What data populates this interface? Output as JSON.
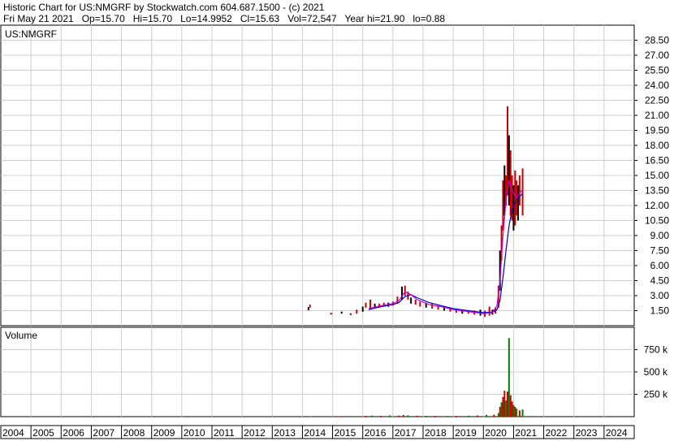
{
  "header": {
    "title_line": "Historic Chart for US:NMGRF by Stockwatch.com 604.687.1500 - (c) 2021",
    "quote_line": "Fri May 21 2021   Op=15.70   Hi=15.70   Lo=14.9952   Cl=15.63   Vol=72,547   Year hi=21.90   lo=0.88"
  },
  "chart_data": [
    {
      "type": "candlestick",
      "title": "US:NMGRF",
      "ylim": [
        0,
        30
      ],
      "y_ticks": [
        "1.50",
        "3.00",
        "4.50",
        "6.00",
        "7.50",
        "9.00",
        "10.50",
        "12.00",
        "13.50",
        "15.00",
        "16.50",
        "18.00",
        "19.50",
        "21.00",
        "22.50",
        "24.00",
        "25.50",
        "27.00",
        "28.50"
      ],
      "grid": true,
      "series": [
        {
          "kind": "price_high_low",
          "points": [
            [
              2014.2,
              1.55,
              1.85
            ],
            [
              2014.25,
              1.8,
              2.1
            ],
            [
              2014.95,
              1.1,
              1.3
            ],
            [
              2015.3,
              1.2,
              1.4
            ],
            [
              2015.6,
              1.05,
              1.25
            ],
            [
              2015.8,
              1.2,
              1.6
            ],
            [
              2016.0,
              1.4,
              1.9
            ],
            [
              2016.1,
              1.8,
              2.3
            ],
            [
              2016.25,
              1.6,
              2.6
            ],
            [
              2016.4,
              1.7,
              2.2
            ],
            [
              2016.55,
              1.8,
              2.2
            ],
            [
              2016.7,
              1.9,
              2.3
            ],
            [
              2016.85,
              1.9,
              2.3
            ],
            [
              2017.0,
              2.0,
              2.4
            ],
            [
              2017.15,
              2.2,
              2.9
            ],
            [
              2017.3,
              2.6,
              3.9
            ],
            [
              2017.4,
              3.0,
              4.0
            ],
            [
              2017.5,
              2.6,
              3.4
            ],
            [
              2017.6,
              2.2,
              2.8
            ],
            [
              2017.75,
              2.1,
              2.6
            ],
            [
              2017.9,
              1.9,
              2.4
            ],
            [
              2018.1,
              1.8,
              2.3
            ],
            [
              2018.3,
              1.7,
              2.2
            ],
            [
              2018.5,
              1.6,
              2.0
            ],
            [
              2018.7,
              1.5,
              1.9
            ],
            [
              2018.9,
              1.4,
              1.8
            ],
            [
              2019.1,
              1.3,
              1.7
            ],
            [
              2019.3,
              1.2,
              1.6
            ],
            [
              2019.5,
              1.2,
              1.5
            ],
            [
              2019.7,
              1.1,
              1.5
            ],
            [
              2019.9,
              1.0,
              1.6
            ],
            [
              2020.05,
              0.88,
              1.5
            ],
            [
              2020.2,
              1.0,
              1.9
            ],
            [
              2020.3,
              1.1,
              1.6
            ],
            [
              2020.4,
              1.2,
              1.8
            ],
            [
              2020.5,
              1.8,
              4.0
            ],
            [
              2020.55,
              3.5,
              7.5
            ],
            [
              2020.6,
              6.5,
              10.0
            ],
            [
              2020.65,
              9.5,
              14.5
            ],
            [
              2020.7,
              11.0,
              16.0
            ],
            [
              2020.75,
              12.0,
              15.0
            ],
            [
              2020.8,
              13.0,
              21.9
            ],
            [
              2020.85,
              12.0,
              19.0
            ],
            [
              2020.9,
              11.0,
              17.5
            ],
            [
              2020.95,
              10.5,
              15.0
            ],
            [
              2021.0,
              9.5,
              14.0
            ],
            [
              2021.05,
              10.0,
              15.5
            ],
            [
              2021.1,
              11.0,
              14.5
            ],
            [
              2021.15,
              10.5,
              14.0
            ],
            [
              2021.2,
              12.0,
              15.0
            ],
            [
              2021.3,
              11.0,
              15.7
            ]
          ]
        },
        {
          "kind": "moving_average",
          "color": "#0000cc",
          "points": [
            [
              2016.2,
              1.6
            ],
            [
              2016.6,
              1.9
            ],
            [
              2017.0,
              2.1
            ],
            [
              2017.2,
              2.3
            ],
            [
              2017.4,
              2.9
            ],
            [
              2017.6,
              3.1
            ],
            [
              2017.8,
              2.8
            ],
            [
              2018.2,
              2.3
            ],
            [
              2018.6,
              2.0
            ],
            [
              2019.0,
              1.7
            ],
            [
              2019.5,
              1.5
            ],
            [
              2020.0,
              1.3
            ],
            [
              2020.3,
              1.35
            ],
            [
              2020.45,
              1.6
            ],
            [
              2020.55,
              2.5
            ],
            [
              2020.65,
              4.8
            ],
            [
              2020.75,
              7.5
            ],
            [
              2020.85,
              10.0
            ],
            [
              2020.95,
              11.6
            ],
            [
              2021.1,
              12.6
            ],
            [
              2021.3,
              13.2
            ]
          ]
        },
        {
          "kind": "moving_average",
          "color": "#cc00cc",
          "points": [
            [
              2016.2,
              1.7
            ],
            [
              2016.6,
              2.0
            ],
            [
              2017.0,
              2.2
            ],
            [
              2017.2,
              2.5
            ],
            [
              2017.4,
              3.4
            ],
            [
              2017.6,
              3.1
            ],
            [
              2017.8,
              2.6
            ],
            [
              2018.2,
              2.1
            ],
            [
              2018.6,
              1.9
            ],
            [
              2019.0,
              1.6
            ],
            [
              2019.5,
              1.4
            ],
            [
              2020.0,
              1.2
            ],
            [
              2020.3,
              1.3
            ],
            [
              2020.45,
              2.0
            ],
            [
              2020.55,
              4.5
            ],
            [
              2020.65,
              9.0
            ],
            [
              2020.75,
              12.5
            ],
            [
              2020.85,
              14.5
            ],
            [
              2020.95,
              13.5
            ],
            [
              2021.1,
              12.8
            ],
            [
              2021.3,
              13.6
            ]
          ]
        }
      ]
    },
    {
      "type": "bar",
      "title": "Volume",
      "ylim": [
        0,
        1000000
      ],
      "y_ticks": [
        "250 k",
        "500 k",
        "750 k"
      ],
      "grid": true,
      "values": [
        [
          2014.3,
          4000,
          "#008000"
        ],
        [
          2015.2,
          5000,
          "#cc0000"
        ],
        [
          2015.7,
          6000,
          "#008000"
        ],
        [
          2016.1,
          9000,
          "#cc0000"
        ],
        [
          2016.3,
          12000,
          "#008000"
        ],
        [
          2016.6,
          10000,
          "#cc0000"
        ],
        [
          2016.9,
          14000,
          "#008000"
        ],
        [
          2017.2,
          12000,
          "#cc0000"
        ],
        [
          2017.35,
          18000,
          "#cc0000"
        ],
        [
          2017.5,
          15000,
          "#008000"
        ],
        [
          2017.8,
          11000,
          "#cc0000"
        ],
        [
          2018.1,
          9000,
          "#008000"
        ],
        [
          2018.4,
          10000,
          "#cc0000"
        ],
        [
          2018.8,
          8000,
          "#008000"
        ],
        [
          2019.1,
          9000,
          "#cc0000"
        ],
        [
          2019.5,
          11000,
          "#008000"
        ],
        [
          2019.8,
          13000,
          "#cc0000"
        ],
        [
          2020.1,
          20000,
          "#008000"
        ],
        [
          2020.35,
          22000,
          "#cc0000"
        ],
        [
          2020.5,
          40000,
          "#008000"
        ],
        [
          2020.55,
          110000,
          "#cc0000"
        ],
        [
          2020.6,
          160000,
          "#008000"
        ],
        [
          2020.65,
          220000,
          "#cc0000"
        ],
        [
          2020.7,
          290000,
          "#cc0000"
        ],
        [
          2020.75,
          180000,
          "#008000"
        ],
        [
          2020.8,
          280000,
          "#cc0000"
        ],
        [
          2020.85,
          880000,
          "#008000"
        ],
        [
          2020.9,
          240000,
          "#cc0000"
        ],
        [
          2020.95,
          170000,
          "#cc0000"
        ],
        [
          2021.0,
          130000,
          "#008000"
        ],
        [
          2021.05,
          110000,
          "#cc0000"
        ],
        [
          2021.1,
          90000,
          "#008000"
        ],
        [
          2021.2,
          70000,
          "#cc0000"
        ],
        [
          2021.3,
          80000,
          "#008000"
        ]
      ]
    }
  ],
  "x_axis": {
    "years": [
      "2004",
      "2005",
      "2006",
      "2007",
      "2008",
      "2009",
      "2010",
      "2011",
      "2012",
      "2013",
      "2014",
      "2015",
      "2016",
      "2017",
      "2018",
      "2019",
      "2020",
      "2021",
      "2022",
      "2023",
      "2024"
    ]
  }
}
